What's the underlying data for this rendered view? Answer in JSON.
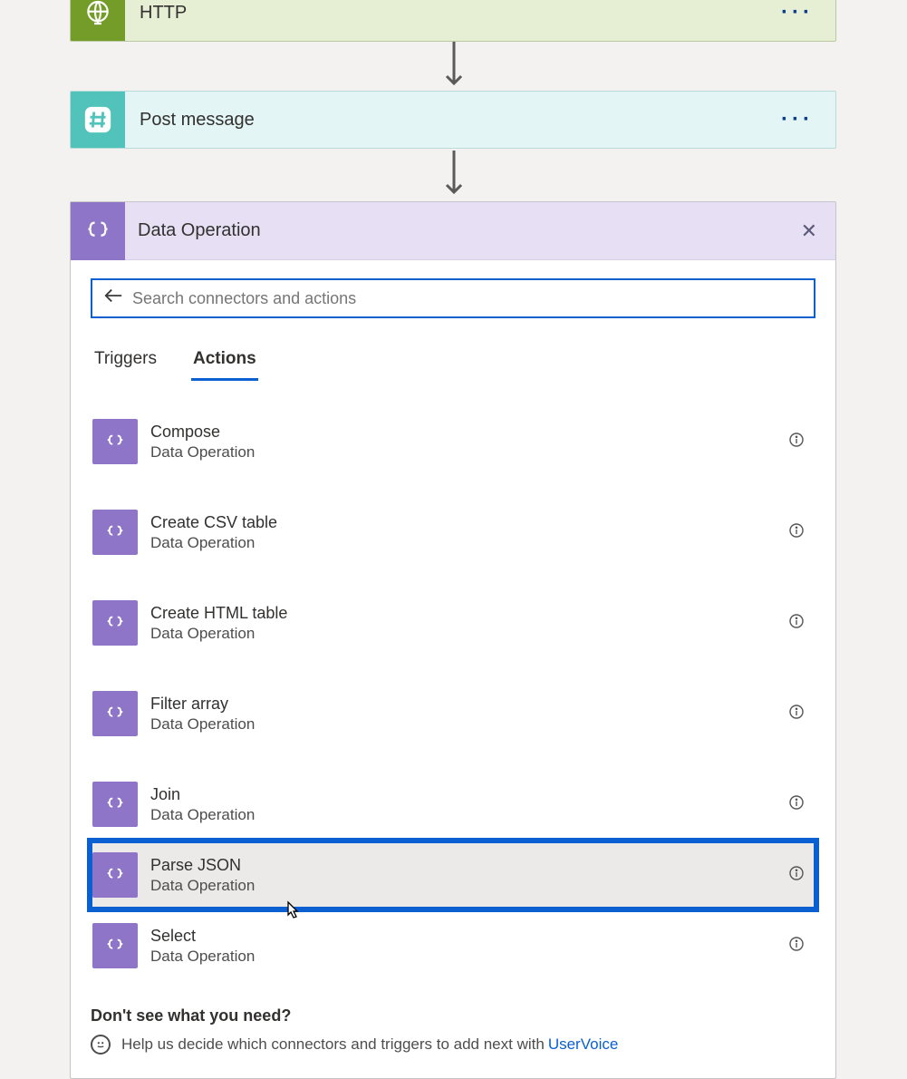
{
  "steps": {
    "http": {
      "title": "HTTP"
    },
    "post": {
      "title": "Post message"
    }
  },
  "card": {
    "title": "Data Operation"
  },
  "search": {
    "placeholder": "Search connectors and actions"
  },
  "tabs": {
    "triggers": "Triggers",
    "actions": "Actions"
  },
  "actions": [
    {
      "name": "Compose",
      "sub": "Data Operation"
    },
    {
      "name": "Create CSV table",
      "sub": "Data Operation"
    },
    {
      "name": "Create HTML table",
      "sub": "Data Operation"
    },
    {
      "name": "Filter array",
      "sub": "Data Operation"
    },
    {
      "name": "Join",
      "sub": "Data Operation"
    },
    {
      "name": "Parse JSON",
      "sub": "Data Operation"
    },
    {
      "name": "Select",
      "sub": "Data Operation"
    }
  ],
  "footer": {
    "question": "Don't see what you need?",
    "help_prefix": "Help us decide which connectors and triggers to add next with",
    "link": "UserVoice"
  }
}
